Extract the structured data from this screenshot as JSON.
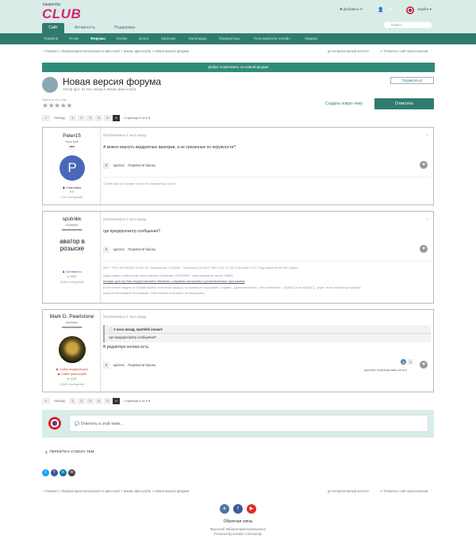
{
  "header": {
    "logo_small": "kaspersky",
    "logo_club": "CLUB",
    "add_label": "✚ Добавить ▾",
    "bell": "👤",
    "mail": "✉",
    "user_name": "Sapfira ▾",
    "tabs": [
      "Сайт",
      "Активность",
      "Поддержка"
    ],
    "search_placeholder": "Поиск..."
  },
  "nav": {
    "items": [
      "Правила",
      "Устав",
      "Форумы",
      "Клубы",
      "Блоги",
      "Загрузки",
      "Календарь",
      "Модераторы",
      "Пользователи онлайн",
      "Лидеры"
    ]
  },
  "breadcrumb": {
    "path": "⌂ Главная  >  Лаборатория Касперского и фан-клуб  >  Жизнь фан-клуба  >  Новая версия форума",
    "unread": "▤ Непрочитанный контент",
    "mark_read": "✔ Отметить сайт прочитанным"
  },
  "banner": "Добро пожаловать на новый форум!",
  "topic": {
    "title": "Новая версия форума",
    "byline": "Автор Igor, 21 час назад в Жизнь фан-клуба",
    "subscribe": "Подписаться",
    "rating_label": "Оценить эту тему",
    "stars": "★★★★★",
    "new_topic": "Создать новую тему",
    "reply": "Ответить"
  },
  "pager": {
    "prev": "«",
    "back": "НАЗАД",
    "pages": [
      "1",
      "2",
      "3",
      "4",
      "5",
      "6"
    ],
    "current": "6",
    "info": "Страница 6 из 6 ▾"
  },
  "posts": [
    {
      "author": "Peter15",
      "title": "Опытный",
      "dots": "●●●",
      "avatar_letter": "P",
      "group": "♟ Участники",
      "rep": "● 6",
      "count": "418 сообщений",
      "meta": "Опубликовано 4 часа назад",
      "text": "А можно вернуть квадратные аватарки, а не срезанные по окружности?",
      "quote": "Цитата",
      "rate": "Перевести баллы",
      "sig": "Слева чисто! Справа чисто! По периметру чисто!"
    },
    {
      "author": "sputnikk",
      "title": "Корифей",
      "dots": "●●●●●●●●●●●●",
      "avatar_text": "аватор в розыске",
      "group": "♟ Активисты",
      "rep": "● 1050",
      "count": "5036 сообщений",
      "meta": "Опубликовано 2 часа назад",
      "text": "где предпросмотр сообщения?",
      "quote": "Цитата",
      "rate": "Перевести баллы",
      "sig1": "Win 7 SP1 x64 MSDN & KAV 20. Компьютер LG A250 - Samsung GALAXY Tab 2 (10.1\") 3G & Android 4.2.2. Под защитой 59 лет. Идиот",
      "sig2": "Адресовано любителям переставлять Windows: СИЛЬНЕЕ, запутавший не лечит. НМКС",
      "sig3": "Конфиг для игр Как переустановить Windows, сохранив настройки и установленные программы",
      "sig4": "Если хотите видеть в CrystalDiskInfo понятные цифры, то измените настройки: Сервис - Дополнительно - Raw значения - 10[DEC] или 16[DEC] - (byte, если некоторые цифры",
      "sig5": "кажутся неоправно большими). Окно можно растянуть по вертикали."
    },
    {
      "author": "Mark D. Pearlstone",
      "title": "Assistant",
      "dots": "●●●●●●●●●●●●",
      "group1": "♟ Супер-модераторы",
      "group2": "♟ Совет фан-клуба",
      "rep": "● 1418",
      "count": "21066 сообщений",
      "meta": "Опубликовано 2 часа назад",
      "quote_head": "🕓 2 часа назад, sputnikk сказал:",
      "quote_body": "где предпросмотр сообщения?",
      "text": "В редакторе кнопка есть.",
      "quote": "Цитата",
      "rate": "Перевести баллы",
      "react_count": "1",
      "reacted": "sputnikk отреагировал на это"
    }
  ],
  "reply_box": {
    "placeholder": "💬 Ответить в этой теме..."
  },
  "back_link": "ПЕРЕЙТИ К СПИСКУ ТЕМ",
  "footer": {
    "feedback": "Обратная связь",
    "line1": "Фан-клуб Лаборатории Касперского",
    "line2": "Powered by Invision Community"
  },
  "colors": {
    "header_bg": "#d9ece8",
    "nav_bg": "#2f7c6d",
    "accent": "#2f7c6d",
    "logo": "#d7256f",
    "banner": "#2f8c78"
  }
}
